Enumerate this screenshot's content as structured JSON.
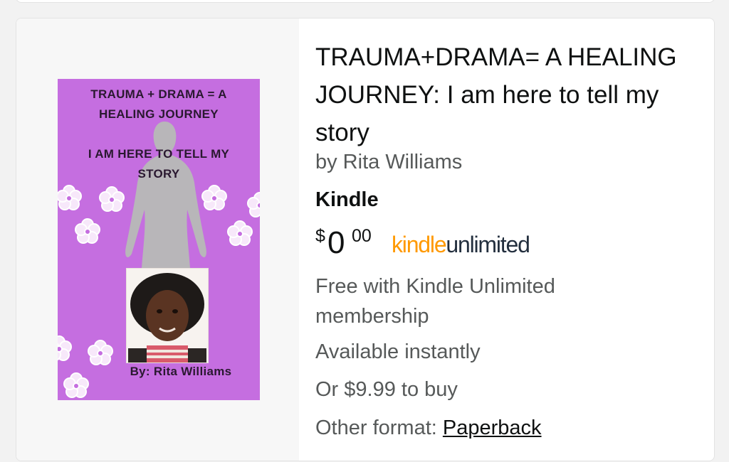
{
  "book": {
    "title": "TRAUMA+DRAMA= A HEALING JOURNEY: I am here to tell my story",
    "byline": "by Rita Williams",
    "format": "Kindle",
    "price": {
      "symbol": "$",
      "whole": "0",
      "fraction": "00"
    },
    "kindle_unlimited": {
      "part1": "kindle",
      "part2": "unlimited"
    },
    "free_with": "Free with Kindle Unlimited membership",
    "availability": "Available instantly",
    "buy_price": "Or $9.99 to buy",
    "other_format_label": "Other format: ",
    "other_format_link": "Paperback"
  },
  "cover": {
    "title": "TRAUMA + DRAMA = A\nHEALING JOURNEY",
    "subtitle": "I AM HERE TO TELL MY\nSTORY",
    "author": "By: Rita Williams"
  },
  "colors": {
    "cover_bg": "#c56ee0",
    "ku_orange": "#ff9900",
    "ku_dark": "#232f3e",
    "text_primary": "#0f1111",
    "text_secondary": "#565959"
  }
}
